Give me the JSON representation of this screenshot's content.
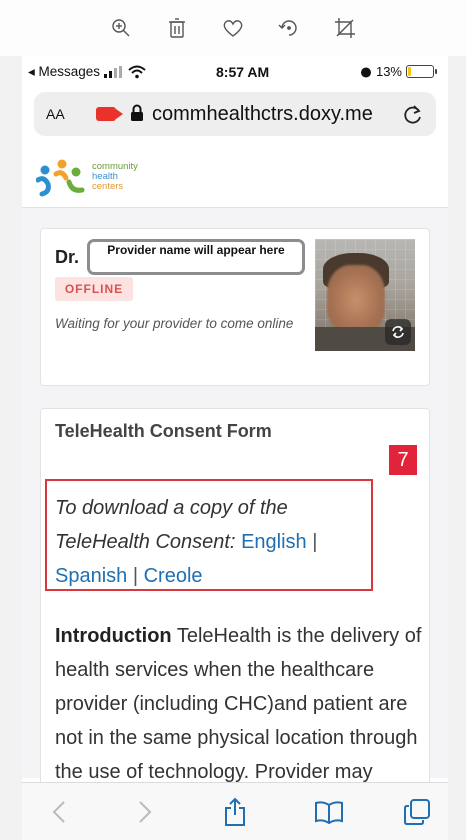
{
  "viewer_toolbar": {
    "icons": [
      "zoom-in-icon",
      "trash-icon",
      "heart-icon",
      "rotate-icon",
      "crop-icon"
    ]
  },
  "status_bar": {
    "back_app": "◂ Messages",
    "time": "8:57 AM",
    "battery_pct": "13%",
    "battery_level": 0.13
  },
  "url_bar": {
    "aa_label": "AA",
    "url": "commhealthctrs.doxy.me"
  },
  "logo": {
    "line1": "community",
    "line2": "health",
    "line3": "centers"
  },
  "provider_card": {
    "dr_prefix": "Dr.",
    "name_placeholder": "Provider name will appear here",
    "status_badge": "OFFLINE",
    "waiting_message": "Waiting for your provider to come online"
  },
  "consent_card": {
    "title": "TeleHealth Consent Form",
    "step_number": "7",
    "download_prompt": "To download a copy of the TeleHealth Consent:",
    "links": [
      "English",
      "Spanish",
      "Creole"
    ],
    "separator": "|",
    "intro_heading": "Introduction",
    "intro_body": "TeleHealth is the delivery of health services when the healthcare provider (including CHC)and patient are not in the same physical location through the use of technology. Provider may include"
  },
  "colors": {
    "link": "#1f6fb2",
    "badge_red": "#e2243b",
    "offline_text": "#d9534f",
    "offline_bg": "#fde2e2",
    "highlight_box": "#d9363e"
  }
}
